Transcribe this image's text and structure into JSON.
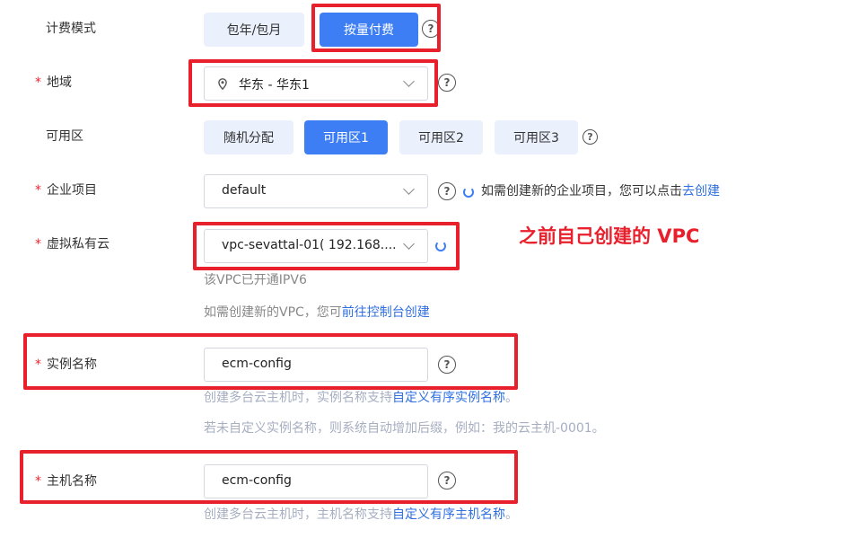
{
  "billing": {
    "label": "计费模式",
    "options": [
      "包年/包月",
      "按量付费"
    ],
    "selected": "按量付费",
    "help_icon": "?"
  },
  "region": {
    "required_mark": "*",
    "label": "地域",
    "value": "华东 - 华东1",
    "help_icon": "?"
  },
  "zone": {
    "label": "可用区",
    "options": [
      "随机分配",
      "可用区1",
      "可用区2",
      "可用区3"
    ],
    "selected": "可用区1",
    "help_icon": "?"
  },
  "enterprise_project": {
    "required_mark": "*",
    "label": "企业项目",
    "value": "default",
    "help_icon": "?",
    "hint": "如需创建新的企业项目，您可以点击",
    "link": "去创建"
  },
  "vpc": {
    "required_mark": "*",
    "label": "虚拟私有云",
    "value": "vpc-sevattal-01( 192.168....",
    "ipv6_note": "该VPC已开通IPV6",
    "create_hint": "如需创建新的VPC，您可",
    "create_link": "前往控制台创建"
  },
  "annotation": "之前自己创建的 VPC",
  "instance_name": {
    "required_mark": "*",
    "label": "实例名称",
    "value": "ecm-config",
    "help_icon": "?",
    "hint1": "创建多台云主机时，实例名称支持",
    "hint1_link": "自定义有序实例名称",
    "hint1_end": "。",
    "hint2": "若未自定义实例名称，则系统自动增加后缀，例如：我的云主机-0001。"
  },
  "host_name": {
    "required_mark": "*",
    "label": "主机名称",
    "value": "ecm-config",
    "help_icon": "?",
    "hint1": "创建多台云主机时，主机名称支持",
    "hint1_link": "自定义有序主机名称",
    "hint1_end": "。"
  },
  "colors": {
    "primary": "#3d7ef5",
    "required": "#f5222d",
    "highlight_box": "#e8202c",
    "link": "#2f6fe0"
  }
}
